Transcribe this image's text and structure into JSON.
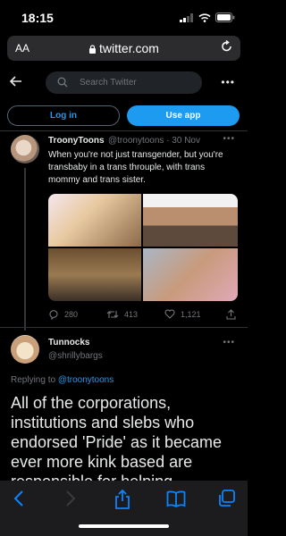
{
  "status": {
    "time": "18:15"
  },
  "browser": {
    "aa": "AA",
    "url": "twitter.com"
  },
  "header": {
    "search_placeholder": "Search Twitter",
    "more": "•••"
  },
  "auth": {
    "login": "Log in",
    "use_app": "Use app"
  },
  "tweet1": {
    "name": "TroonyToons",
    "meta": "@troonytoons · 30 Nov",
    "more": "•••",
    "text": "When you're not just transgender, but you're transbaby in a trans throuple, with trans mommy and trans sister.",
    "replies": "280",
    "retweets": "413",
    "likes": "1,121"
  },
  "tweet2": {
    "name": "Tunnocks",
    "handle": "@shrillybargs",
    "more": "•••",
    "reply_prefix": "Replying to",
    "reply_target": "@troonytoons",
    "text": "All of the corporations, institutions and slebs who endorsed 'Pride' as it became ever more kink based are responsible for helping normalise this **** being out in"
  },
  "colors": {
    "accent": "#1d9bf0",
    "background": "#000000",
    "safari_accent": "#0a84ff"
  }
}
